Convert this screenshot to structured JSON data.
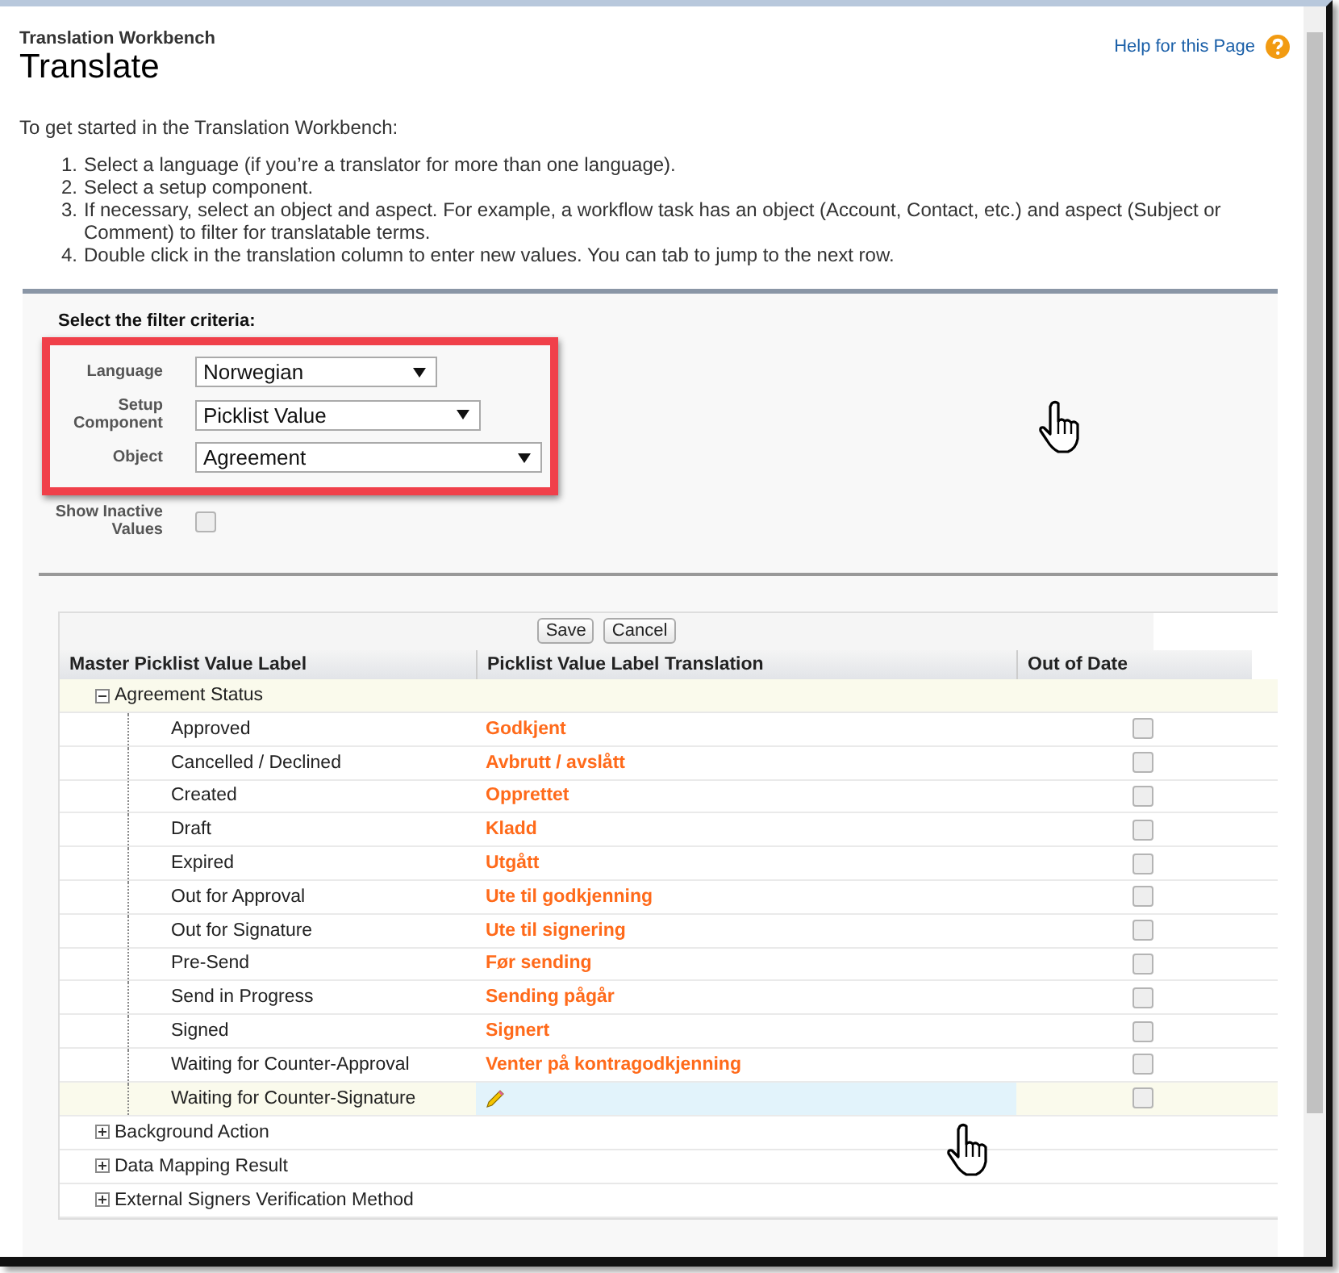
{
  "header": {
    "breadcrumb": "Translation Workbench",
    "title": "Translate",
    "help_link": "Help for this Page"
  },
  "intro": "To get started in the Translation Workbench:",
  "steps": [
    {
      "number": "1.",
      "text": "Select a language (if you’re a translator for more than one language)."
    },
    {
      "number": "2.",
      "text": "Select a setup component."
    },
    {
      "number": "3.",
      "text": "If necessary, select an object and aspect. For example, a workflow task has an object (Account, Contact, etc.) and aspect (Subject or Comment) to filter for translatable terms."
    },
    {
      "number": "4.",
      "text": "Double click in the translation column to enter new values. You can tab to jump to the next row."
    }
  ],
  "filter": {
    "heading": "Select the filter criteria:",
    "fields": [
      {
        "label": "Language",
        "kind": "select",
        "value": "Norwegian",
        "highlighted": true
      },
      {
        "label": "Setup Component",
        "kind": "select",
        "value": "Picklist Value",
        "highlighted": true
      },
      {
        "label": "Object",
        "kind": "select",
        "value": "Agreement",
        "highlighted": true
      },
      {
        "label": "Show Inactive Values",
        "kind": "checkbox",
        "checked": false,
        "highlighted": false
      }
    ]
  },
  "buttons": [
    "Save",
    "Cancel"
  ],
  "table": {
    "columns": [
      "Master Picklist Value Label",
      "Picklist Value Label Translation",
      "Out of Date"
    ],
    "groups": [
      {
        "name": "Agreement Status",
        "expanded": true,
        "children": [
          {
            "label": "Approved",
            "translation": "Godkjent",
            "out_of_date": false,
            "selected": false
          },
          {
            "label": "Cancelled / Declined",
            "translation": "Avbrutt / avslått",
            "out_of_date": false,
            "selected": false
          },
          {
            "label": "Created",
            "translation": "Opprettet",
            "out_of_date": false,
            "selected": false
          },
          {
            "label": "Draft",
            "translation": "Kladd",
            "out_of_date": false,
            "selected": false
          },
          {
            "label": "Expired",
            "translation": "Utgått",
            "out_of_date": false,
            "selected": false
          },
          {
            "label": "Out for Approval",
            "translation": "Ute til godkjenning",
            "out_of_date": false,
            "selected": false
          },
          {
            "label": "Out for Signature",
            "translation": "Ute til signering",
            "out_of_date": false,
            "selected": false
          },
          {
            "label": "Pre-Send",
            "translation": "Før sending",
            "out_of_date": false,
            "selected": false
          },
          {
            "label": "Send in Progress",
            "translation": "Sending pågår",
            "out_of_date": false,
            "selected": false
          },
          {
            "label": "Signed",
            "translation": "Signert",
            "out_of_date": false,
            "selected": false
          },
          {
            "label": "Waiting for Counter-Approval",
            "translation": "Venter på kontragodkjenning",
            "out_of_date": false,
            "selected": false
          },
          {
            "label": "Waiting for Counter-Signature",
            "out_of_date": false,
            "selected": true
          }
        ]
      },
      {
        "name": "Background Action",
        "expanded": false
      },
      {
        "name": "Data Mapping Result",
        "expanded": false
      },
      {
        "name": "External Signers Verification Method",
        "expanded": false
      }
    ]
  }
}
